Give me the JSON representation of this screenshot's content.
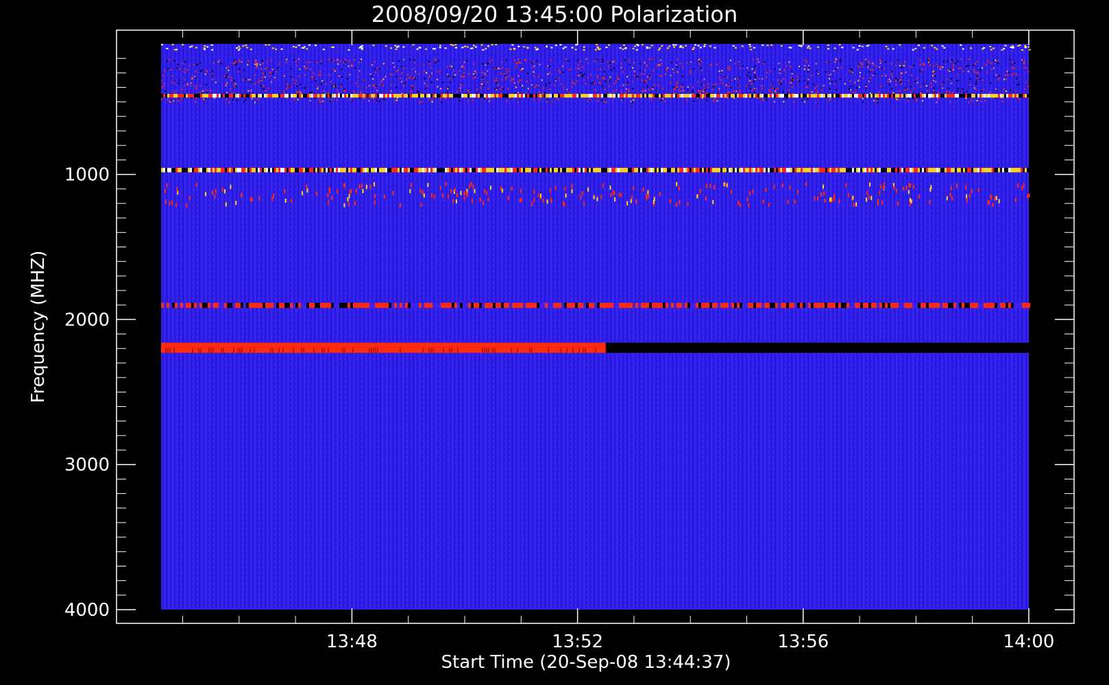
{
  "chart_data": {
    "type": "heatmap",
    "title": "2008/09/20 13:45:00 Polarization",
    "xlabel": "Start Time (20-Sep-08 13:44:37)",
    "ylabel": "Frequency (MHZ)",
    "x_range": [
      "13:44:37",
      "14:00:00"
    ],
    "y_range_mhz": [
      100,
      4000
    ],
    "y_axis_inverted": true,
    "x_ticks": [
      "13:48",
      "13:52",
      "13:56",
      "14:00"
    ],
    "y_ticks": [
      1000,
      2000,
      3000,
      4000
    ],
    "grid": false,
    "colormap": {
      "background": "#2a1ee8",
      "hot": "#ff2a10",
      "bright": "#ffd21e",
      "dark": "#000000"
    },
    "features": [
      {
        "freq_mhz": [
          200,
          500
        ],
        "kind": "noisy-band"
      },
      {
        "freq_mhz": [
          445,
          470
        ],
        "kind": "bright-band"
      },
      {
        "freq_mhz": [
          955,
          985
        ],
        "kind": "bright-band"
      },
      {
        "freq_mhz": [
          1050,
          1200
        ],
        "kind": "sparse-band"
      },
      {
        "freq_mhz": [
          1885,
          1920
        ],
        "kind": "hot-band"
      },
      {
        "freq_mhz": [
          2160,
          2230
        ],
        "kind": "hot-to-dark-band",
        "transition_time": "13:52:30"
      }
    ]
  }
}
